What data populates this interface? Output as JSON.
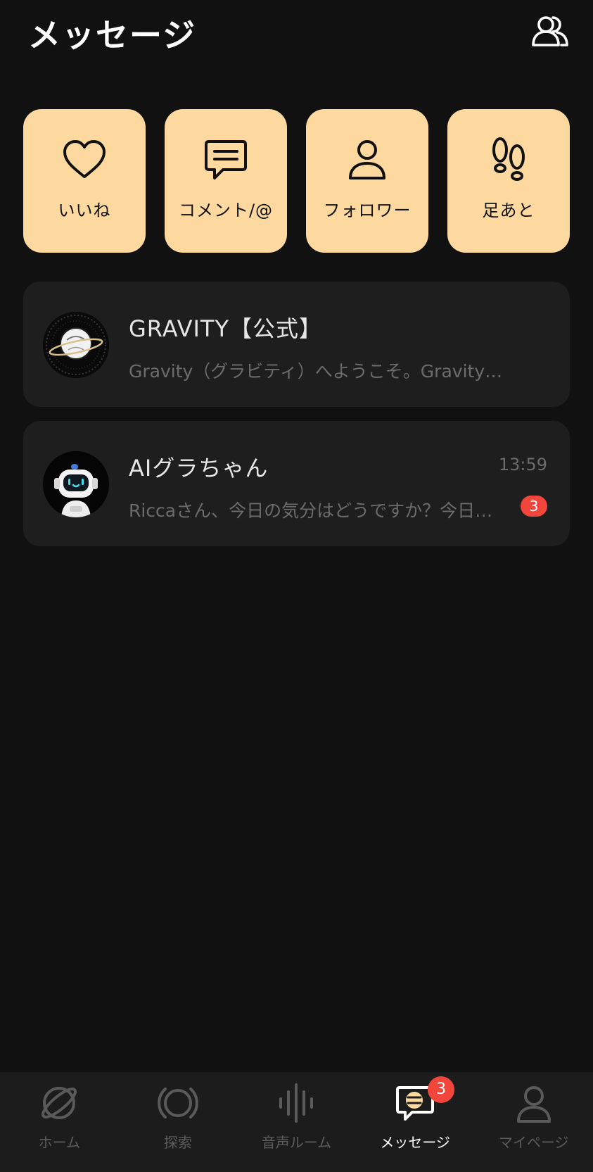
{
  "header": {
    "title": "メッセージ",
    "friends_icon": "people-icon"
  },
  "quick_actions": [
    {
      "label": "いいね",
      "icon": "heart-icon"
    },
    {
      "label": "コメント/@",
      "icon": "comment-icon"
    },
    {
      "label": "フォロワー",
      "icon": "person-icon"
    },
    {
      "label": "足あと",
      "icon": "footprints-icon"
    }
  ],
  "conversations": [
    {
      "name": "GRAVITY【公式】",
      "preview": "Gravity（グラビティ）へようこそ。Gravity…",
      "time": "",
      "unread": ""
    },
    {
      "name": "AIグラちゃん",
      "preview": "Riccaさん、今日の気分はどうですか？今日…",
      "time": "13:59",
      "unread": "3"
    }
  ],
  "tabbar": {
    "tabs": [
      {
        "label": "ホーム",
        "icon": "planet-icon"
      },
      {
        "label": "探索",
        "icon": "explore-ring-icon"
      },
      {
        "label": "音声ルーム",
        "icon": "soundwave-icon"
      },
      {
        "label": "メッセージ",
        "icon": "chat-bubble-icon",
        "badge": "3"
      },
      {
        "label": "マイページ",
        "icon": "profile-icon"
      }
    ],
    "active_index": 3
  },
  "colors": {
    "background": "#111111",
    "card": "#1e1e1e",
    "accent": "#fdd9a0",
    "badge": "#f2463c",
    "muted_text": "#6c6c6c"
  }
}
